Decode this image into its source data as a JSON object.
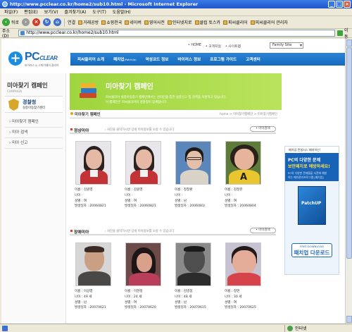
{
  "window": {
    "title": "http://www.pcclear.co.kr/home2/sub10.html - Microsoft Internet Explorer"
  },
  "menubar": [
    "파일(F)",
    "편집(E)",
    "보기(V)",
    "즐겨찾기(A)",
    "도구(T)",
    "도움말(H)"
  ],
  "toolbar": {
    "back": "뒤로",
    "links_label": "연결",
    "links": [
      "거래공방",
      "쇼핑천국",
      "네이버",
      "영어사전",
      "인터넷지로",
      "클럽 토스카",
      "피씨클리어",
      "피씨클리어 관리자"
    ]
  },
  "addressbar": {
    "label": "주소(D)",
    "url": "http://www.pcclear.co.kr/home2/sub10.html",
    "go": "이동"
  },
  "site": {
    "toplinks": [
      "• HOME",
      "• 고객지원",
      "• 사이트맵"
    ],
    "family_site": "Family Site",
    "logo_main": "PC",
    "logo_italic": "CLEAR",
    "logo_sub": "바이러스 & 스파이웨어 클리어",
    "gnb": [
      {
        "label": "피씨클리어 소개"
      },
      {
        "label": "패치업",
        "small": "(PatchUp)"
      },
      {
        "label": "악성코드 정보"
      },
      {
        "label": "바이러스 정보"
      },
      {
        "label": "프로그램 가이드"
      },
      {
        "label": "고객센터"
      }
    ]
  },
  "lnb": {
    "title": "미아찾기 캠페인",
    "subtitle": "CAMPAIGN",
    "police_title": "경찰청",
    "police_sub": "실종아동찾기센터",
    "menu": [
      "› 미아찾기 캠페인",
      "› 미아 검색",
      "› 미아 신고"
    ]
  },
  "banner": {
    "title": "미아찾기 캠페인",
    "desc1": "피씨클리어 실종아동찾기 캠페인에서는 관리인을 통한 실종신고 및 검색을 지원하고 있습니다.",
    "desc2": "이 캠페인은 피씨클리어와 경찰청이 함께합니다."
  },
  "subhead": {
    "title": "미아찾기 캠페인",
    "breadcrumb": "home > 미아찾기캠페인 > 미아찾기캠페인"
  },
  "sections": [
    {
      "title": "정상미아",
      "desc": "› 사진을 클릭하시면 상세 미아정보를 보실 수 있습니다.",
      "more": "• 미아검색",
      "cards": [
        {
          "name": "이름 : 김원영",
          "age": "나이 :",
          "gender": "성별 : 여",
          "date": "발생일자 : 20060821"
        },
        {
          "name": "이름 : 김원영",
          "age": "나이 :",
          "gender": "성별 : 여",
          "date": "발생일자 : 20060821"
        },
        {
          "name": "이름 : 정창환",
          "age": "나이 :",
          "gender": "성별 : 남",
          "date": "발생일자 : 2006081("
        },
        {
          "name": "이름 : 김정은",
          "age": "나이 :",
          "gender": "성별 : 여",
          "date": "발생일자 : 20060804"
        }
      ]
    },
    {
      "title": "장애미아",
      "desc": "› 사진을 클릭하시면 상세 미아정보를 보실 수 있습니다.",
      "more": "• 미아검색",
      "cards": [
        {
          "name": "이름 : 이상열",
          "age": "나이 : 49 세",
          "gender": "성별 : 남",
          "date": "발생일자 : 20070621"
        },
        {
          "name": "이름 : 이현정",
          "age": "나이 : 24 세",
          "gender": "성별 : 여",
          "date": "발생일자 : 20070620"
        },
        {
          "name": "이름 : 김병봉",
          "age": "나이 : 48 세",
          "gender": "성별 : 남",
          "date": "발생일자 : 20070615"
        },
        {
          "name": "이름 : 정연",
          "age": "나이 : 30 세",
          "gender": "성별 : 여",
          "date": "발생일자 : 20070625"
        }
      ]
    }
  ],
  "ad": {
    "top": "패치업 컨설시스 폐지하는!",
    "h1": "PC의 다양한 문제",
    "h2": "보안패치로 예방하세요!",
    "s1": "PC의 다양한 문제들을 사전에 예방",
    "s2": "하는 패치관리프로그램 [패치업]",
    "box": "PatchUP",
    "free_small": "FREE DOWNLOAD",
    "free_big": "패치업 다운로드"
  },
  "statusbar": {
    "text": "",
    "zone": "인터넷"
  },
  "colors": {
    "gnb_blue": "#1c75c8",
    "banner_green": "#a9dc48",
    "accent_orange": "#e6a21a"
  }
}
